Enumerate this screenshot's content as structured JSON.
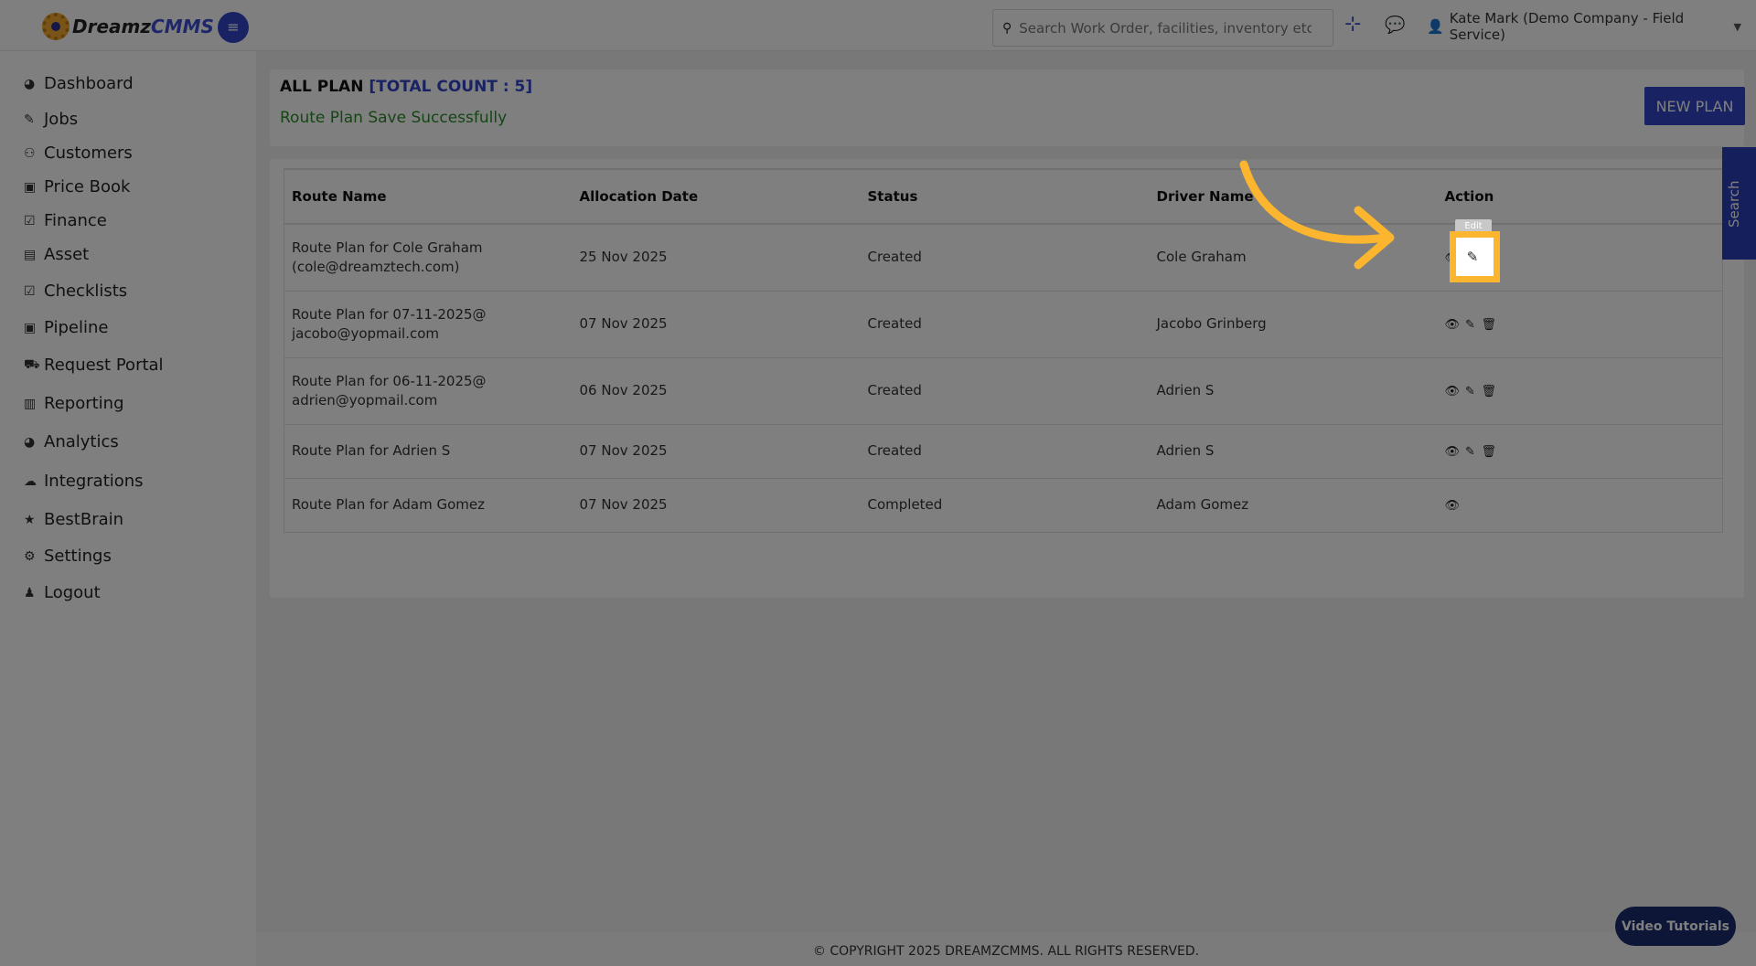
{
  "brand": {
    "name_part1": "Dreamz",
    "name_part2": "CMMS"
  },
  "topbar": {
    "search_placeholder": "Search Work Order, facilities, inventory etc...",
    "user_label": "Kate Mark (Demo Company - Field Service)"
  },
  "sidebar": {
    "items": [
      {
        "label": "Dashboard",
        "icon": "dashboard-icon"
      },
      {
        "label": "Jobs",
        "icon": "wrench-icon"
      },
      {
        "label": "Customers",
        "icon": "users-icon"
      },
      {
        "label": "Price Book",
        "icon": "money-icon"
      },
      {
        "label": "Finance",
        "icon": "check-square-icon"
      },
      {
        "label": "Asset",
        "icon": "archive-icon"
      },
      {
        "label": "Checklists",
        "icon": "check-square-icon"
      },
      {
        "label": "Pipeline",
        "icon": "money-icon"
      },
      {
        "label": "Request Portal",
        "icon": "cart-icon"
      },
      {
        "label": "Reporting",
        "icon": "file-icon"
      },
      {
        "label": "Analytics",
        "icon": "dashboard-icon"
      },
      {
        "label": "Integrations",
        "icon": "cloud-icon"
      },
      {
        "label": "BestBrain",
        "icon": "star-icon"
      },
      {
        "label": "Settings",
        "icon": "gear-icon"
      },
      {
        "label": "Logout",
        "icon": "user-icon"
      }
    ]
  },
  "header": {
    "title": "ALL PLAN",
    "count_label": "[TOTAL COUNT : 5]",
    "success_message": "Route Plan Save Successfully",
    "new_plan_label": "NEW PLAN"
  },
  "table": {
    "columns": [
      "Route Name",
      "Allocation Date",
      "Status",
      "Driver Name",
      "Action"
    ],
    "rows": [
      {
        "route_line1": "Route Plan for Cole Graham",
        "route_line2": "(cole@dreamztech.com)",
        "date": "25 Nov 2025",
        "status": "Created",
        "driver": "Cole Graham"
      },
      {
        "route_line1": "Route Plan for 07-11-2025@",
        "route_line2": "jacobo@yopmail.com",
        "date": "07 Nov 2025",
        "status": "Created",
        "driver": "Jacobo Grinberg"
      },
      {
        "route_line1": "Route Plan for 06-11-2025@",
        "route_line2": "adrien@yopmail.com",
        "date": "06 Nov 2025",
        "status": "Created",
        "driver": "Adrien S"
      },
      {
        "route_line1": "Route Plan for Adrien S",
        "route_line2": "",
        "date": "07 Nov 2025",
        "status": "Created",
        "driver": "Adrien S"
      },
      {
        "route_line1": "Route Plan for Adam Gomez",
        "route_line2": "",
        "date": "07 Nov 2025",
        "status": "Completed",
        "driver": "Adam Gomez"
      }
    ]
  },
  "tooltip": "Edit",
  "footer": {
    "copyright": "© COPYRIGHT 2025 DREAMZCMMS. ALL RIGHTS RESERVED."
  },
  "side_search_label": "Search",
  "video_tutorials_label": "Video Tutorials",
  "colors": {
    "accent": "#3347c7",
    "success": "#2a8a2a",
    "highlight": "#fcb52e"
  }
}
